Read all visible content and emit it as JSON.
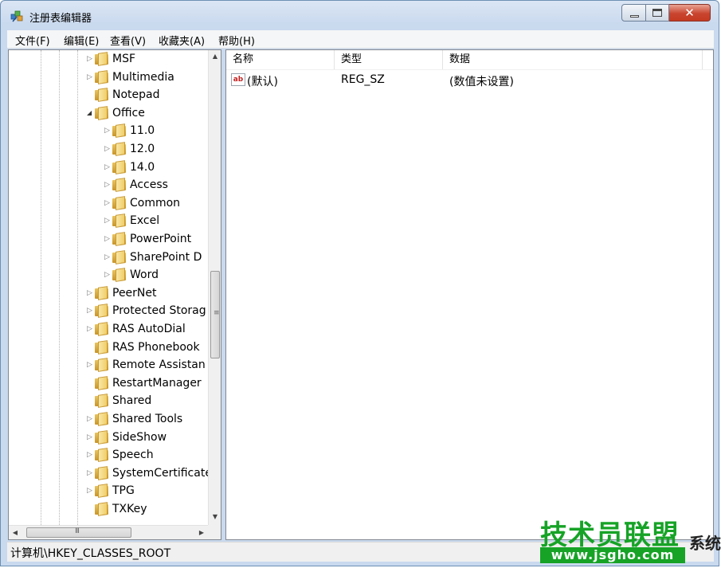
{
  "window": {
    "title": "注册表编辑器"
  },
  "menu": [
    "文件(F)",
    "编辑(E)",
    "查看(V)",
    "收藏夹(A)",
    "帮助(H)"
  ],
  "tree": {
    "items": [
      {
        "label": "MSF",
        "level": 0,
        "expander": "collapsed"
      },
      {
        "label": "Multimedia",
        "level": 0,
        "expander": "collapsed"
      },
      {
        "label": "Notepad",
        "level": 0,
        "expander": "none"
      },
      {
        "label": "Office",
        "level": 0,
        "expander": "expanded"
      },
      {
        "label": "11.0",
        "level": 1,
        "expander": "collapsed"
      },
      {
        "label": "12.0",
        "level": 1,
        "expander": "collapsed"
      },
      {
        "label": "14.0",
        "level": 1,
        "expander": "collapsed"
      },
      {
        "label": "Access",
        "level": 1,
        "expander": "collapsed"
      },
      {
        "label": "Common",
        "level": 1,
        "expander": "collapsed"
      },
      {
        "label": "Excel",
        "level": 1,
        "expander": "collapsed"
      },
      {
        "label": "PowerPoint",
        "level": 1,
        "expander": "collapsed"
      },
      {
        "label": "SharePoint D",
        "level": 1,
        "expander": "collapsed"
      },
      {
        "label": "Word",
        "level": 1,
        "expander": "collapsed"
      },
      {
        "label": "PeerNet",
        "level": 0,
        "expander": "collapsed"
      },
      {
        "label": "Protected Storag",
        "level": 0,
        "expander": "collapsed"
      },
      {
        "label": "RAS AutoDial",
        "level": 0,
        "expander": "collapsed"
      },
      {
        "label": "RAS Phonebook",
        "level": 0,
        "expander": "none"
      },
      {
        "label": "Remote Assistan",
        "level": 0,
        "expander": "collapsed"
      },
      {
        "label": "RestartManager",
        "level": 0,
        "expander": "none"
      },
      {
        "label": "Shared",
        "level": 0,
        "expander": "none"
      },
      {
        "label": "Shared Tools",
        "level": 0,
        "expander": "collapsed"
      },
      {
        "label": "SideShow",
        "level": 0,
        "expander": "collapsed"
      },
      {
        "label": "Speech",
        "level": 0,
        "expander": "collapsed"
      },
      {
        "label": "SystemCertificate",
        "level": 0,
        "expander": "collapsed"
      },
      {
        "label": "TPG",
        "level": 0,
        "expander": "collapsed"
      },
      {
        "label": "TXKey",
        "level": 0,
        "expander": "none"
      }
    ]
  },
  "values": {
    "columns": [
      "名称",
      "类型",
      "数据"
    ],
    "rows": [
      {
        "icon": "ab",
        "name": "(默认)",
        "type": "REG_SZ",
        "data": "(数值未设置)"
      }
    ]
  },
  "status": {
    "path": "计算机\\HKEY_CLASSES_ROOT"
  },
  "watermark": {
    "title": "技术员联盟",
    "side": "系统大全",
    "url": "www.jsgho.com"
  },
  "colors": {
    "watermark_green": "#16a326",
    "close_red": "#c9452f"
  }
}
